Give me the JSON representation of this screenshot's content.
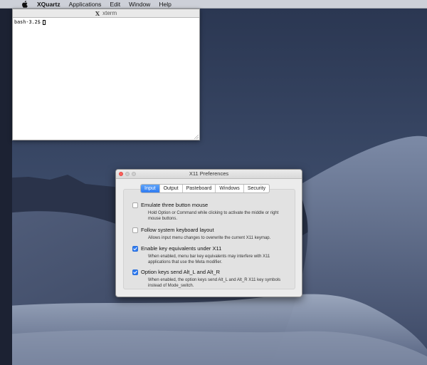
{
  "menubar": {
    "app": "XQuartz",
    "items": [
      "Applications",
      "Edit",
      "Window",
      "Help"
    ]
  },
  "xterm": {
    "title": "xterm",
    "prompt": "bash-3.2$"
  },
  "prefs": {
    "title": "X11 Preferences",
    "tabs": [
      "Input",
      "Output",
      "Pasteboard",
      "Windows",
      "Security"
    ],
    "active_tab": "Input",
    "options": [
      {
        "label": "Emulate three button mouse",
        "checked": false,
        "description": "Hold Option or Command while clicking to activate the middle or right mouse buttons."
      },
      {
        "label": "Follow system keyboard layout",
        "checked": false,
        "description": "Allows input menu changes to overwrite the current X11 keymap."
      },
      {
        "label": "Enable key equivalents under X11",
        "checked": true,
        "description": "When enabled, menu bar key equivalents may interfere with X11 applications that use the Meta modifier."
      },
      {
        "label": "Option keys send Alt_L and Alt_R",
        "checked": true,
        "description": "When enabled, the option keys send Alt_L and Alt_R X11 key symbols instead of Mode_switch."
      }
    ]
  },
  "colors": {
    "accent": "#2f7bf1",
    "close_light": "#fc605c",
    "desktop_sky": "#27324a"
  }
}
